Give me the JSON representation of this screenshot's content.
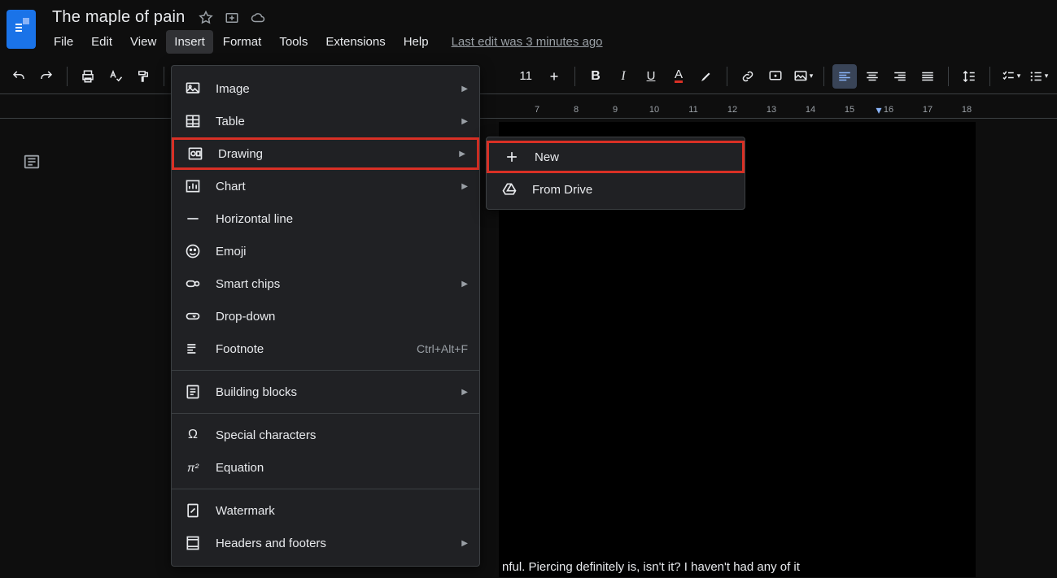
{
  "doc_title": "The maple of pain",
  "menus": {
    "file": "File",
    "edit": "Edit",
    "view": "View",
    "insert": "Insert",
    "format": "Format",
    "tools": "Tools",
    "extensions": "Extensions",
    "help": "Help"
  },
  "last_edit": "Last edit was 3 minutes ago",
  "toolbar": {
    "font_size_fragment": "11"
  },
  "insert_menu": {
    "image": "Image",
    "table": "Table",
    "drawing": "Drawing",
    "chart": "Chart",
    "hline": "Horizontal line",
    "emoji": "Emoji",
    "smart_chips": "Smart chips",
    "dropdown": "Drop-down",
    "footnote": "Footnote",
    "footnote_shortcut": "Ctrl+Alt+F",
    "building_blocks": "Building blocks",
    "special_chars": "Special characters",
    "equation": "Equation",
    "watermark": "Watermark",
    "headers_footers": "Headers and footers"
  },
  "drawing_submenu": {
    "new": "New",
    "from_drive": "From Drive"
  },
  "ruler_numbers": [
    "7",
    "8",
    "9",
    "10",
    "11",
    "12",
    "13",
    "14",
    "15",
    "16",
    "17",
    "18"
  ],
  "page_text": "nful. Piercing definitely is, isn't it? I haven't had any of it"
}
